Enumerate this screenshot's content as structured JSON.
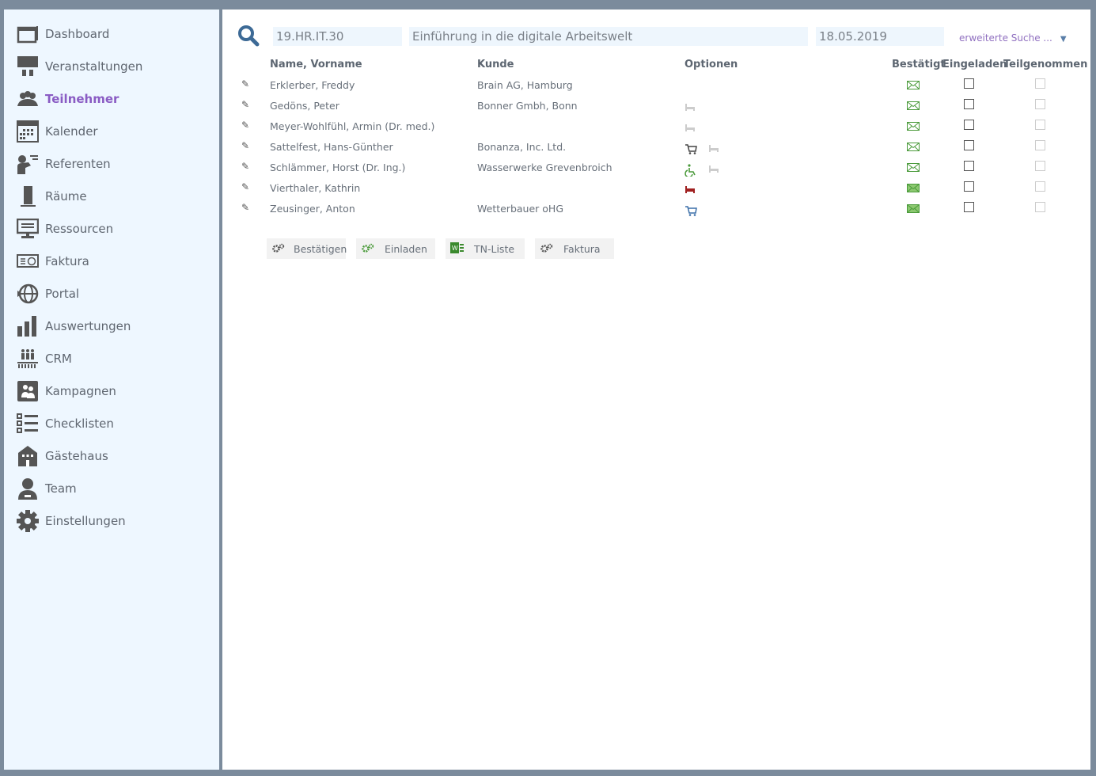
{
  "sidebar": {
    "items": [
      {
        "label": "Dashboard",
        "icon": "dashboard-icon"
      },
      {
        "label": "Veranstaltungen",
        "icon": "presentation-icon"
      },
      {
        "label": "Teilnehmer",
        "icon": "users-icon",
        "active": true
      },
      {
        "label": "Kalender",
        "icon": "calendar-icon"
      },
      {
        "label": "Referenten",
        "icon": "speaker-icon"
      },
      {
        "label": "Räume",
        "icon": "door-icon"
      },
      {
        "label": "Ressourcen",
        "icon": "monitor-icon"
      },
      {
        "label": "Faktura",
        "icon": "invoice-icon"
      },
      {
        "label": "Portal",
        "icon": "globe-icon"
      },
      {
        "label": "Auswertungen",
        "icon": "bar-chart-icon"
      },
      {
        "label": "CRM",
        "icon": "crm-icon"
      },
      {
        "label": "Kampagnen",
        "icon": "campaign-icon"
      },
      {
        "label": "Checklisten",
        "icon": "checklist-icon"
      },
      {
        "label": "Gästehaus",
        "icon": "guesthouse-icon"
      },
      {
        "label": "Team",
        "icon": "person-icon"
      },
      {
        "label": "Einstellungen",
        "icon": "gear-icon"
      }
    ]
  },
  "search": {
    "code": "19.HR.IT.30",
    "title": "Einführung in die digitale Arbeitswelt",
    "date": "18.05.2019",
    "advanced": "erweiterte Suche ..."
  },
  "table": {
    "headers": {
      "name": "Name, Vorname",
      "kunde": "Kunde",
      "optionen": "Optionen",
      "bestaetigt": "Bestätigt",
      "eingeladen": "Eingeladen",
      "teilgenommen": "Teilgenommen"
    },
    "rows": [
      {
        "name": "Erklerber, Freddy",
        "kunde": "Brain AG, Hamburg",
        "options": [],
        "mail_filled": false
      },
      {
        "name": "Gedöns, Peter",
        "kunde": "Bonner Gmbh, Bonn",
        "options": [
          "bed-grey"
        ],
        "mail_filled": false
      },
      {
        "name": "Meyer-Wohlfühl, Armin (Dr. med.)",
        "kunde": "",
        "options": [
          "bed-grey"
        ],
        "mail_filled": false
      },
      {
        "name": "Sattelfest, Hans-Günther",
        "kunde": "Bonanza, Inc. Ltd.",
        "options": [
          "cart-dark",
          "bed-grey"
        ],
        "mail_filled": false
      },
      {
        "name": "Schlämmer, Horst (Dr. Ing.)",
        "kunde": "Wasserwerke Grevenbroich",
        "options": [
          "wheelchair-green",
          "bed-grey"
        ],
        "mail_filled": false
      },
      {
        "name": "Vierthaler, Kathrin",
        "kunde": "",
        "options": [
          "bed-red"
        ],
        "mail_filled": true
      },
      {
        "name": "Zeusinger, Anton",
        "kunde": "Wetterbauer oHG",
        "options": [
          "cart-blue"
        ],
        "mail_filled": true
      }
    ]
  },
  "buttons": [
    {
      "label": "Bestätigen",
      "icon": "gears-icon"
    },
    {
      "label": "Einladen",
      "icon": "gears-green-icon"
    },
    {
      "label": "TN-Liste",
      "icon": "word-icon"
    },
    {
      "label": "Faktura",
      "icon": "gears-icon"
    }
  ],
  "colors": {
    "accent": "#8a5cc4",
    "green": "#4a9a3a",
    "red": "#a02020",
    "blue": "#3a6ea8"
  }
}
